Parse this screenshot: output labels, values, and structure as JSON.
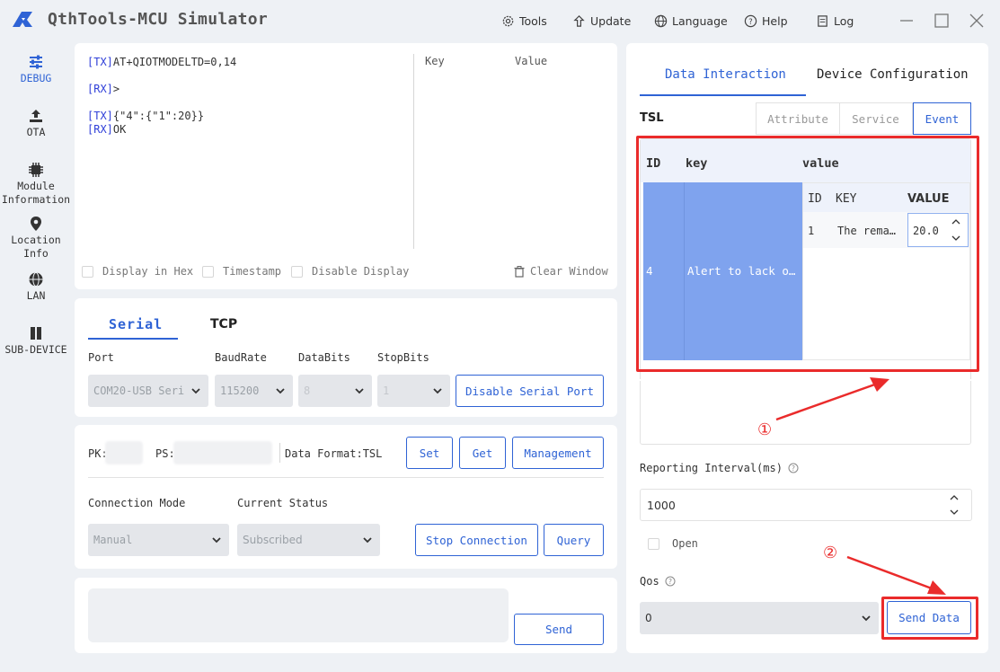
{
  "app": {
    "title": "QthTools-MCU Simulator"
  },
  "toolbar": {
    "tools": "Tools",
    "update": "Update",
    "language": "Language",
    "help": "Help",
    "log": "Log"
  },
  "sidebar": {
    "items": [
      {
        "label": "DEBUG"
      },
      {
        "label": "OTA"
      },
      {
        "label": "Module Information"
      },
      {
        "label": "Location Info"
      },
      {
        "label": "LAN"
      },
      {
        "label": "SUB-DEVICE"
      }
    ]
  },
  "log": {
    "lines": [
      {
        "tag": "[TX]",
        "text": "AT+QIOTMODELTD=0,14"
      },
      {
        "tag": "[RX]",
        "text": ">"
      },
      {
        "tag": "[TX]",
        "text": "{\"4\":{\"1\":20}}"
      },
      {
        "tag": "[RX]",
        "text": "OK"
      }
    ],
    "kv_key": "Key",
    "kv_value": "Value",
    "opt_hex": "Display in Hex",
    "opt_timestamp": "Timestamp",
    "opt_disable": "Disable Display",
    "clear": "Clear Window"
  },
  "serial": {
    "tab_serial": "Serial",
    "tab_tcp": "TCP",
    "port_label": "Port",
    "baud_label": "BaudRate",
    "databits_label": "DataBits",
    "stopbits_label": "StopBits",
    "port_value": "COM20-USB Seri",
    "baud_value": "115200",
    "databits_value": "8",
    "stopbits_value": "1",
    "disable_btn": "Disable Serial Port"
  },
  "conn": {
    "pk_label": "PK:",
    "ps_label": "PS:",
    "format": "Data Format:TSL",
    "set": "Set",
    "get": "Get",
    "management": "Management",
    "mode_label": "Connection Mode",
    "status_label": "Current Status",
    "mode_value": "Manual",
    "status_value": "Subscribed",
    "stop": "Stop Connection",
    "query": "Query"
  },
  "send": {
    "button": "Send"
  },
  "right": {
    "tab_data": "Data Interaction",
    "tab_device": "Device Configuration",
    "tsl_label": "TSL",
    "seg_attribute": "Attribute",
    "seg_service": "Service",
    "seg_event": "Event",
    "table": {
      "h_id": "ID",
      "h_key": "key",
      "h_value": "value",
      "row_id": "4",
      "row_key": "Alert to lack o…",
      "inner": {
        "h_id": "ID",
        "h_key": "KEY",
        "h_value": "VALUE",
        "id": "1",
        "key": "The rema…",
        "value": "20.0"
      }
    },
    "annot1": "①",
    "annot2": "②",
    "interval_label": "Reporting Interval(ms)",
    "interval_value": "1000",
    "open_label": "Open",
    "qos_label": "Qos",
    "qos_value": "0",
    "send_data": "Send Data"
  },
  "colors": {
    "accent": "#2f63d5",
    "row_selected": "#7fa3ee",
    "annotation": "#ea2b2b"
  }
}
